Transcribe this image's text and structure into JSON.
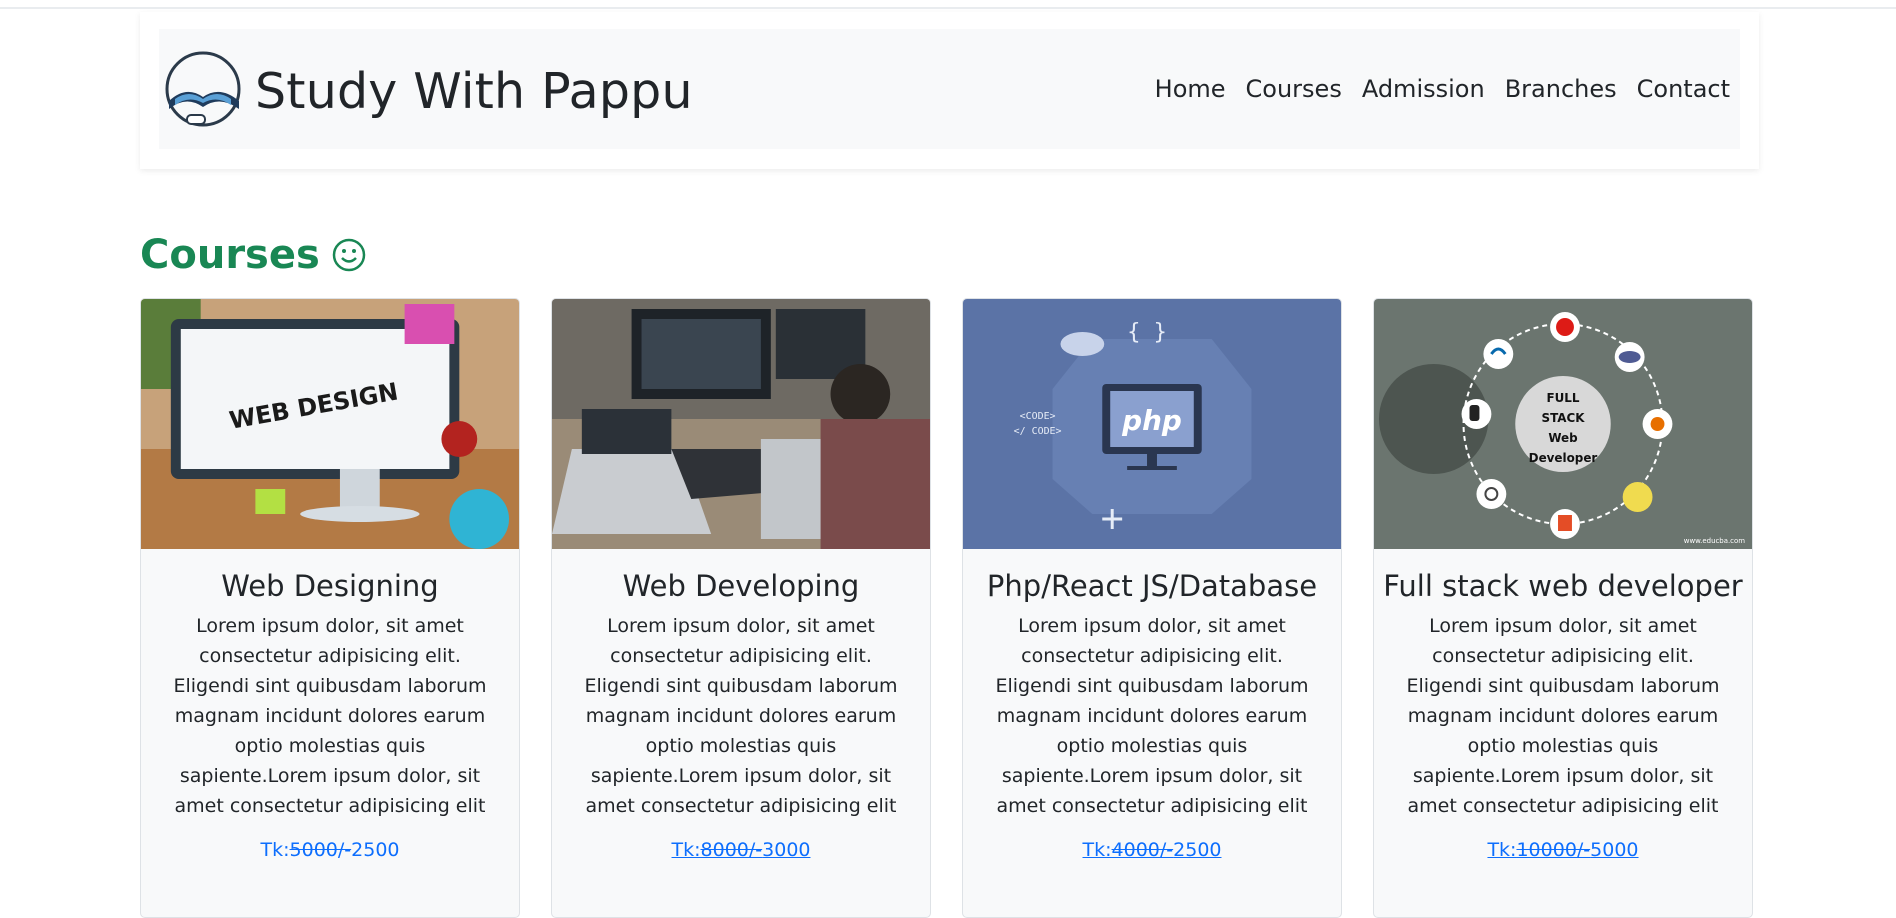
{
  "site": {
    "brand_title": "Study With Pappu"
  },
  "nav": {
    "items": [
      "Home",
      "Courses",
      "Admission",
      "Branches",
      "Contact"
    ]
  },
  "section": {
    "heading": "Courses"
  },
  "courses": [
    {
      "title": "Web Designing",
      "description": "Lorem ipsum dolor, sit amet consectetur adipisicing elit. Eligendi sint quibusdam laborum magnam incidunt dolores earum optio molestias quis sapiente.Lorem ipsum dolor, sit amet consectetur adipisicing elit",
      "price_prefix": "Tk:",
      "old_price": "5000/-",
      "new_price": "2500",
      "image_text": "WEB DESIGN"
    },
    {
      "title": "Web Developing",
      "description": "Lorem ipsum dolor, sit amet consectetur adipisicing elit. Eligendi sint quibusdam laborum magnam incidunt dolores earum optio molestias quis sapiente.Lorem ipsum dolor, sit amet consectetur adipisicing elit",
      "price_prefix": "Tk:",
      "old_price": "8000/-",
      "new_price": "3000"
    },
    {
      "title": "Php/React JS/Database",
      "description": "Lorem ipsum dolor, sit amet consectetur adipisicing elit. Eligendi sint quibusdam laborum magnam incidunt dolores earum optio molestias quis sapiente.Lorem ipsum dolor, sit amet consectetur adipisicing elit",
      "price_prefix": "Tk:",
      "old_price": "4000/-",
      "new_price": "2500",
      "image_text": "php",
      "image_code_text": "<CODE>",
      "image_code_text2": "</ CODE>"
    },
    {
      "title": "Full stack web developer",
      "description": "Lorem ipsum dolor, sit amet consectetur adipisicing elit. Eligendi sint quibusdam laborum magnam incidunt dolores earum optio molestias quis sapiente.Lorem ipsum dolor, sit amet consectetur adipisicing elit",
      "price_prefix": "Tk:",
      "old_price": "10000/-",
      "new_price": "5000",
      "image_text_lines": [
        "FULL",
        "STACK",
        "Web",
        "Developer"
      ],
      "image_credit": "www.educba.com"
    }
  ],
  "colors": {
    "accent_green": "#198754",
    "link_blue": "#0d6efd",
    "card_bg": "#f8f9fa",
    "php_bg": "#5b73a6",
    "fullstack_bg": "#6b756f"
  }
}
